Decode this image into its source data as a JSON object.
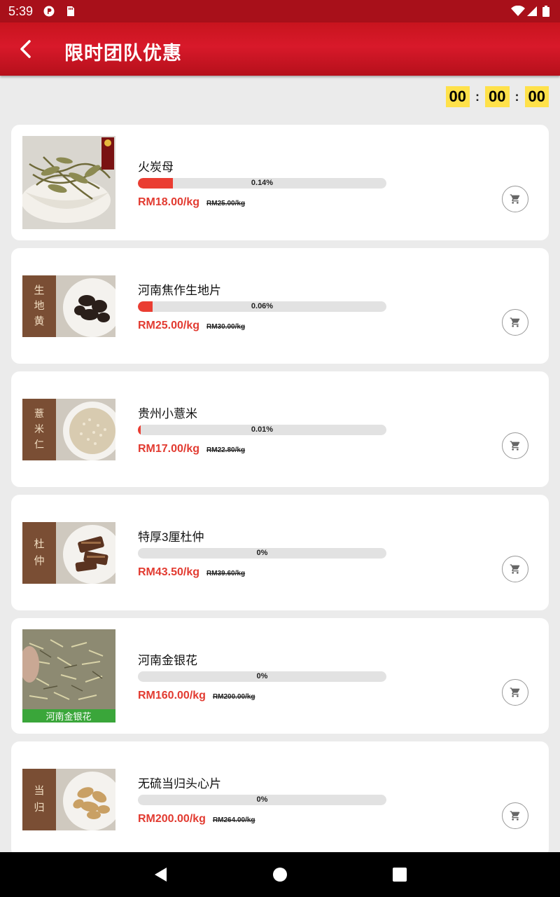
{
  "status_bar": {
    "time": "5:39"
  },
  "header": {
    "title": "限时团队优惠"
  },
  "countdown": {
    "hours": "00",
    "minutes": "00",
    "seconds": "00",
    "separator": ":"
  },
  "colors": {
    "brand_red": "#d8192a",
    "price_red": "#e23b31",
    "countdown_yellow": "#ffe14a",
    "progress_fill": "#ea3d32"
  },
  "products": [
    {
      "name": "火炭母",
      "progress_text": "0.14%",
      "progress_fraction": 0.14,
      "price": "RM18.00/kg",
      "old_price": "RM25.00/kg",
      "image_label": ""
    },
    {
      "name": "河南焦作生地片",
      "progress_text": "0.06%",
      "progress_fraction": 0.06,
      "price": "RM25.00/kg",
      "old_price": "RM30.00/kg",
      "image_label": "生地黄"
    },
    {
      "name": "贵州小薏米",
      "progress_text": "0.01%",
      "progress_fraction": 0.01,
      "price": "RM17.00/kg",
      "old_price": "RM22.80/kg",
      "image_label": "薏米仁"
    },
    {
      "name": "特厚3厘杜仲",
      "progress_text": "0%",
      "progress_fraction": 0,
      "price": "RM43.50/kg",
      "old_price": "RM39.60/kg",
      "image_label": "杜仲"
    },
    {
      "name": "河南金银花",
      "progress_text": "0%",
      "progress_fraction": 0,
      "price": "RM160.00/kg",
      "old_price": "RM200.00/kg",
      "image_label": "河南金银花"
    },
    {
      "name": "无硫当归头心片",
      "progress_text": "0%",
      "progress_fraction": 0,
      "price": "RM200.00/kg",
      "old_price": "RM264.00/kg",
      "image_label": "当归"
    }
  ],
  "icons": {
    "back": "arrow-back-icon",
    "cart": "cart-icon",
    "nav_back": "triangle-back-icon",
    "nav_home": "circle-home-icon",
    "nav_recents": "square-recents-icon"
  }
}
